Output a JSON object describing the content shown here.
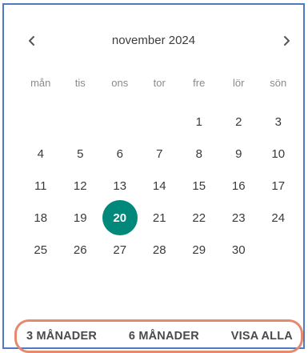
{
  "calendar": {
    "month_title": "november 2024",
    "prev_icon": "chevron-left-icon",
    "next_icon": "chevron-right-icon",
    "weekdays": [
      "mån",
      "tis",
      "ons",
      "tor",
      "fre",
      "lör",
      "sön"
    ],
    "leading_blanks": 4,
    "days": [
      "1",
      "2",
      "3",
      "4",
      "5",
      "6",
      "7",
      "8",
      "9",
      "10",
      "11",
      "12",
      "13",
      "14",
      "15",
      "16",
      "17",
      "18",
      "19",
      "20",
      "21",
      "22",
      "23",
      "24",
      "25",
      "26",
      "27",
      "28",
      "29",
      "30"
    ],
    "selected_day": "20",
    "accent_color": "#00897b"
  },
  "footer": {
    "three_months": "3 MÅNADER",
    "six_months": "6 MÅNADER",
    "show_all": "VISA ALLA",
    "highlight_color": "#e5896f"
  },
  "frame_color": "#4f79c2"
}
